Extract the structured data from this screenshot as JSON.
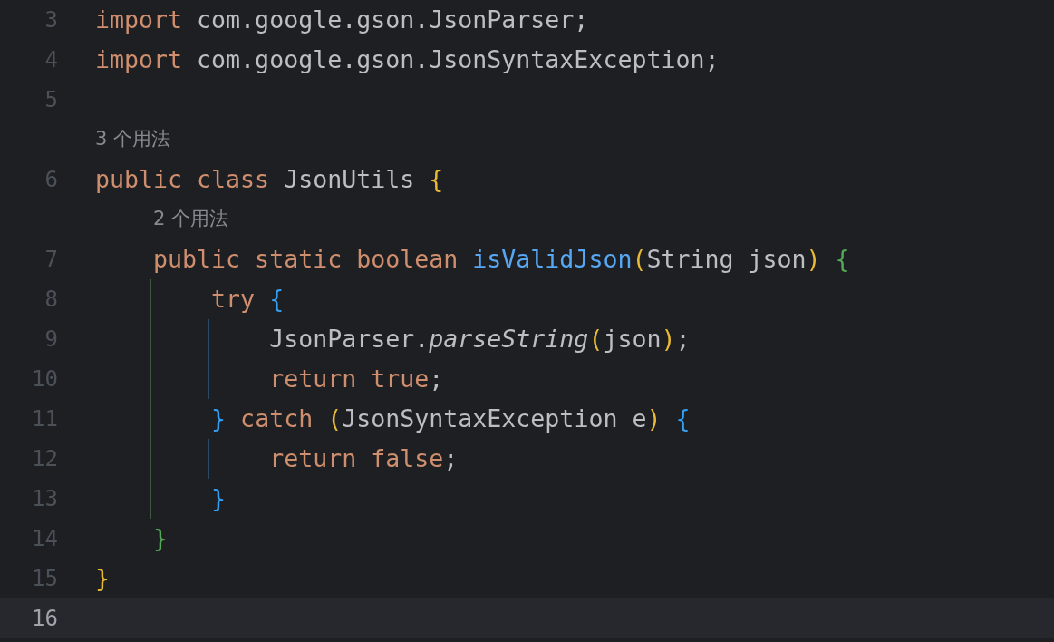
{
  "editor": {
    "lines": [
      {
        "kind": "code",
        "number": "3",
        "current": false,
        "tokens": [
          {
            "text": "import ",
            "kind": "keyword"
          },
          {
            "text": "com.google.gson.JsonParser;",
            "kind": "plain"
          }
        ]
      },
      {
        "kind": "code",
        "number": "4",
        "current": false,
        "tokens": [
          {
            "text": "import ",
            "kind": "keyword"
          },
          {
            "text": "com.google.gson.JsonSyntaxException;",
            "kind": "plain"
          }
        ]
      },
      {
        "kind": "code",
        "number": "5",
        "current": false
      },
      {
        "kind": "hint",
        "text": "3 个用法"
      },
      {
        "kind": "code",
        "number": "6",
        "current": false,
        "tokens": [
          {
            "text": "public class ",
            "kind": "keyword"
          },
          {
            "text": "JsonUtils ",
            "kind": "plain"
          },
          {
            "text": "{",
            "kind": "brace1"
          }
        ]
      },
      {
        "kind": "hint",
        "text": "    2 个用法"
      },
      {
        "kind": "code",
        "number": "7",
        "current": false,
        "tokens": [
          {
            "text": "    public static boolean ",
            "kind": "keyword"
          },
          {
            "text": "isValidJson",
            "kind": "method"
          },
          {
            "text": "(",
            "kind": "brace1"
          },
          {
            "text": "String json",
            "kind": "plain"
          },
          {
            "text": ")",
            "kind": "brace1"
          },
          {
            "text": " {",
            "kind": "brace2"
          }
        ]
      },
      {
        "kind": "code",
        "number": "8",
        "current": false,
        "tokens": [
          {
            "text": "        try ",
            "kind": "keyword"
          },
          {
            "text": "{",
            "kind": "brace3"
          }
        ]
      },
      {
        "kind": "code",
        "number": "9",
        "current": false,
        "tokens": [
          {
            "text": "            JsonParser.",
            "kind": "plain"
          },
          {
            "text": "parseString",
            "kind": "static"
          },
          {
            "text": "(",
            "kind": "brace1"
          },
          {
            "text": "json",
            "kind": "plain"
          },
          {
            "text": ")",
            "kind": "brace1"
          },
          {
            "text": ";",
            "kind": "plain"
          }
        ]
      },
      {
        "kind": "code",
        "number": "10",
        "current": false,
        "tokens": [
          {
            "text": "            return true",
            "kind": "keyword"
          },
          {
            "text": ";",
            "kind": "plain"
          }
        ]
      },
      {
        "kind": "code",
        "number": "11",
        "current": false,
        "tokens": [
          {
            "text": "        }",
            "kind": "brace3"
          },
          {
            "text": " catch ",
            "kind": "keyword"
          },
          {
            "text": "(",
            "kind": "brace1"
          },
          {
            "text": "JsonSyntaxException e",
            "kind": "plain"
          },
          {
            "text": ")",
            "kind": "brace1"
          },
          {
            "text": " {",
            "kind": "brace3"
          }
        ]
      },
      {
        "kind": "code",
        "number": "12",
        "current": false,
        "tokens": [
          {
            "text": "            return false",
            "kind": "keyword"
          },
          {
            "text": ";",
            "kind": "plain"
          }
        ]
      },
      {
        "kind": "code",
        "number": "13",
        "current": false,
        "tokens": [
          {
            "text": "        }",
            "kind": "brace3"
          }
        ]
      },
      {
        "kind": "code",
        "number": "14",
        "current": false,
        "tokens": [
          {
            "text": "    }",
            "kind": "brace2"
          }
        ]
      },
      {
        "kind": "code",
        "number": "15",
        "current": false,
        "tokens": [
          {
            "text": "}",
            "kind": "brace1"
          }
        ]
      },
      {
        "kind": "code",
        "number": "16",
        "current": true
      }
    ]
  }
}
